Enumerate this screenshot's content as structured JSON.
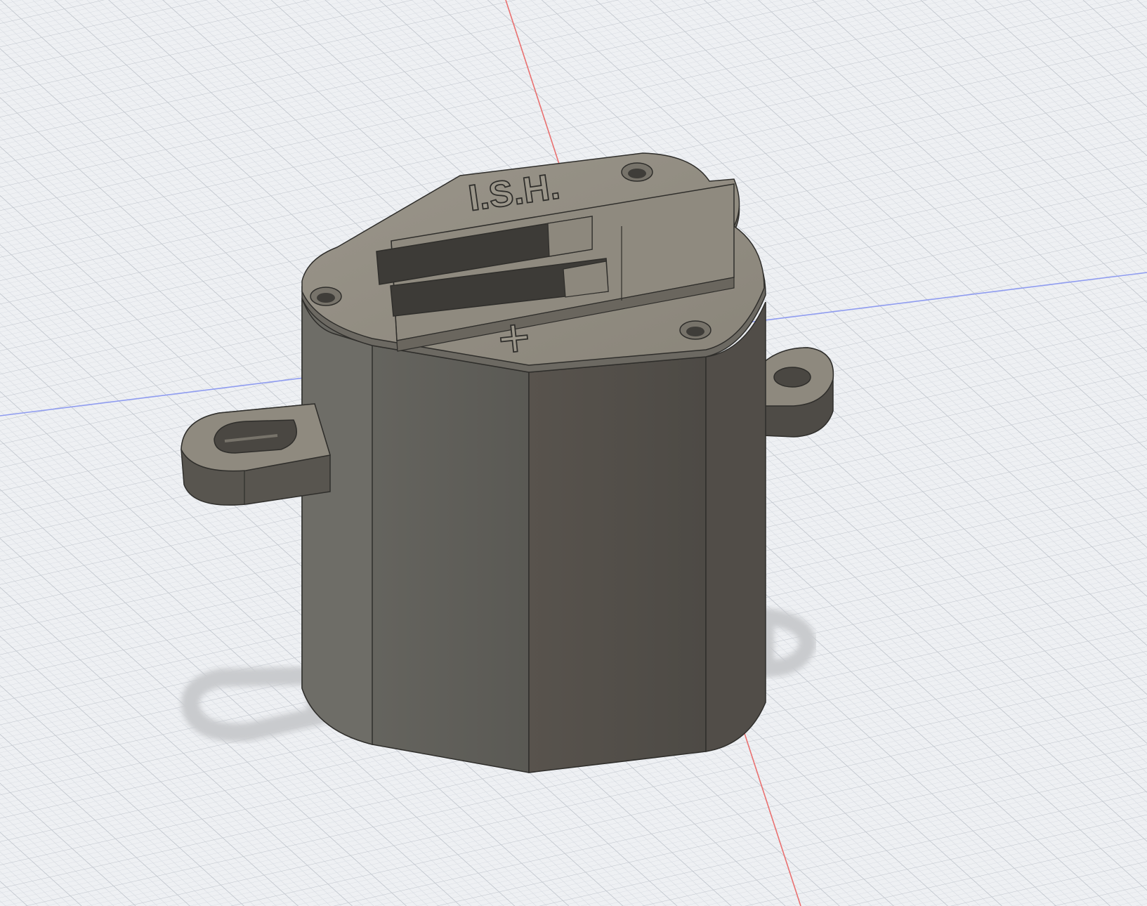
{
  "viewport": {
    "background": "#eef0f3",
    "grid_minor_color": "#d6dae0",
    "grid_major_color": "#c3c8cf",
    "axis_x_color": "#e96a6a",
    "axis_y_color": "#8b98ea"
  },
  "model": {
    "embossed_text": "I.S.H.",
    "polarity_symbol": "+",
    "body_color_front": "#5f5e58",
    "body_color_right": "#55514b",
    "top_color": "#928d82",
    "edge_color": "#2f2e2b"
  }
}
